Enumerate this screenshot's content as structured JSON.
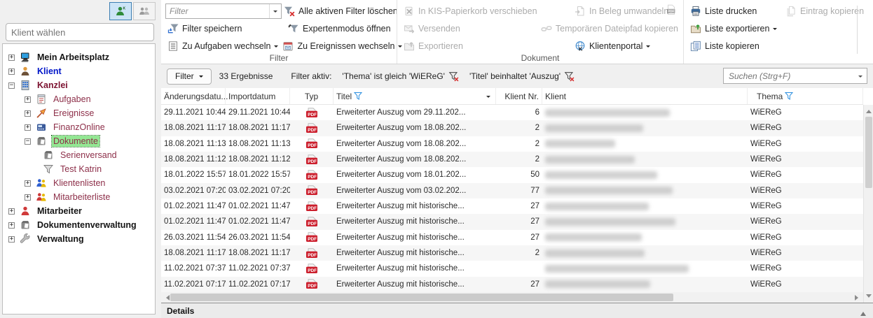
{
  "colors": {
    "selection_green": "#93e793",
    "pdf_red": "#cc1f2d",
    "filter_funnel_blue": "#2b8fe0",
    "remove_x_red": "#d62b2b",
    "selected_mode_blue": "#cce4f7"
  },
  "sidebar": {
    "client_select_placeholder": "Klient wählen",
    "mode_buttons": [
      {
        "name": "single-client",
        "icon": "person-single",
        "selected": true
      },
      {
        "name": "client-group",
        "icon": "person-group",
        "selected": false
      }
    ],
    "tree": [
      {
        "label": "Mein Arbeitsplatz",
        "level": 0,
        "expand": "plus",
        "icon": "workstation",
        "variant": "root"
      },
      {
        "label": "Klient",
        "level": 0,
        "expand": "plus",
        "icon": "person-client",
        "variant": "root-blue"
      },
      {
        "label": "Kanzlei",
        "level": 0,
        "expand": "minus",
        "icon": "office-building",
        "variant": "root-maroon"
      },
      {
        "label": "Aufgaben",
        "level": 1,
        "expand": "plus",
        "icon": "notepad",
        "variant": "child"
      },
      {
        "label": "Ereignisse",
        "level": 1,
        "expand": "plus",
        "icon": "event-arrow",
        "variant": "child"
      },
      {
        "label": "FinanzOnline",
        "level": 1,
        "expand": "plus",
        "icon": "finanz-terminal",
        "variant": "child"
      },
      {
        "label": "Dokumente",
        "level": 1,
        "expand": "minus",
        "icon": "document-box",
        "variant": "child",
        "selected": true
      },
      {
        "label": "Serienversand",
        "level": 2,
        "expand": "none",
        "icon": "document-box",
        "variant": "child"
      },
      {
        "label": "Test Katrin",
        "level": 2,
        "expand": "none",
        "icon": "funnel-gray",
        "variant": "child"
      },
      {
        "label": "Klientenlisten",
        "level": 1,
        "expand": "plus",
        "icon": "people-blue",
        "variant": "child"
      },
      {
        "label": "Mitarbeiterliste",
        "level": 1,
        "expand": "plus",
        "icon": "people-red",
        "variant": "child"
      },
      {
        "label": "Mitarbeiter",
        "level": 0,
        "expand": "plus",
        "icon": "person-red",
        "variant": "root"
      },
      {
        "label": "Dokumentenverwaltung",
        "level": 0,
        "expand": "plus",
        "icon": "document-box",
        "variant": "root"
      },
      {
        "label": "Verwaltung",
        "level": 0,
        "expand": "plus",
        "icon": "wrench",
        "variant": "root"
      }
    ]
  },
  "ribbon": {
    "filter_group": {
      "label": "Filter",
      "combo_placeholder": "Filter",
      "clear_all": "Alle aktiven Filter löschen",
      "save": "Filter speichern",
      "expert": "Expertenmodus öffnen",
      "to_tasks": "Zu Aufgaben wechseln",
      "to_events": "Zu Ereignissen wechseln"
    },
    "document_group": {
      "label": "Dokument",
      "kis_trash": "In KIS-Papierkorb verschieben",
      "convert": "In Beleg umwandeln",
      "send": "Versenden",
      "copy_path": "Temporären Dateipfad kopieren",
      "export": "Exportieren",
      "portal": "Klientenportal"
    },
    "list_group": {
      "print": "Liste drucken",
      "export": "Liste exportieren",
      "copy": "Liste kopieren",
      "copy_entry": "Eintrag kopieren"
    }
  },
  "filterbar": {
    "filter_button": "Filter",
    "results": "33 Ergebnisse",
    "active_label": "Filter aktiv:",
    "filters": [
      "'Thema' ist gleich 'WiEReG'",
      "'Titel' beinhaltet 'Auszug'"
    ],
    "search_placeholder": "Suchen (Strg+F)"
  },
  "table": {
    "columns": {
      "aenderungsdatum": "Änderungsdatu...",
      "importdatum": "Importdatum",
      "typ": "Typ",
      "titel": "Titel",
      "klient_nr": "Klient Nr.",
      "klient": "Klient",
      "thema": "Thema"
    },
    "rows": [
      {
        "aenderungsdatum": "29.11.2021 10:44",
        "importdatum": "29.11.2021 10:44",
        "typ": "PDF",
        "titel": "Erweiterter Auszug vom 29.11.202...",
        "klient_nr": "6",
        "klient_redacted_width": 178,
        "thema": "WiEReG"
      },
      {
        "aenderungsdatum": "18.08.2021 11:17",
        "importdatum": "18.08.2021 11:17",
        "typ": "PDF",
        "titel": "Erweiterter Auszug vom 18.08.202...",
        "klient_nr": "2",
        "klient_redacted_width": 140,
        "thema": "WiEReG"
      },
      {
        "aenderungsdatum": "18.08.2021 11:13",
        "importdatum": "18.08.2021 11:13",
        "typ": "PDF",
        "titel": "Erweiterter Auszug vom 18.08.202...",
        "klient_nr": "2",
        "klient_redacted_width": 100,
        "thema": "WiEReG"
      },
      {
        "aenderungsdatum": "18.08.2021 11:12",
        "importdatum": "18.08.2021 11:12",
        "typ": "PDF",
        "titel": "Erweiterter Auszug vom 18.08.202...",
        "klient_nr": "2",
        "klient_redacted_width": 128,
        "thema": "WiEReG"
      },
      {
        "aenderungsdatum": "18.01.2022 15:57",
        "importdatum": "18.01.2022 15:57",
        "typ": "PDF",
        "titel": "Erweiterter Auszug vom 18.01.202...",
        "klient_nr": "50",
        "klient_redacted_width": 160,
        "thema": "WiEReG"
      },
      {
        "aenderungsdatum": "03.02.2021 07:20",
        "importdatum": "03.02.2021 07:20",
        "typ": "PDF",
        "titel": "Erweiterter Auszug vom 03.02.202...",
        "klient_nr": "77",
        "klient_redacted_width": 182,
        "thema": "WiEReG"
      },
      {
        "aenderungsdatum": "01.02.2021 11:47",
        "importdatum": "01.02.2021 11:47",
        "typ": "PDF",
        "titel": "Erweiterter Auszug mit historische...",
        "klient_nr": "27",
        "klient_redacted_width": 148,
        "thema": "WiEReG"
      },
      {
        "aenderungsdatum": "01.02.2021 11:47",
        "importdatum": "01.02.2021 11:47",
        "typ": "PDF",
        "titel": "Erweiterter Auszug mit historische...",
        "klient_nr": "27",
        "klient_redacted_width": 186,
        "thema": "WiEReG"
      },
      {
        "aenderungsdatum": "26.03.2021 11:54",
        "importdatum": "26.03.2021 11:54",
        "typ": "PDF",
        "titel": "Erweiterter Auszug mit historische...",
        "klient_nr": "27",
        "klient_redacted_width": 138,
        "thema": "WiEReG"
      },
      {
        "aenderungsdatum": "18.08.2021 11:17",
        "importdatum": "18.08.2021 11:17",
        "typ": "PDF",
        "titel": "Erweiterter Auszug mit historische...",
        "klient_nr": "2",
        "klient_redacted_width": 142,
        "thema": "WiEReG"
      },
      {
        "aenderungsdatum": "11.02.2021 07:37",
        "importdatum": "11.02.2021 07:37",
        "typ": "PDF",
        "titel": "Erweiterter Auszug mit historische...",
        "klient_nr": "",
        "klient_redacted_width": 205,
        "thema": "WiEReG"
      },
      {
        "aenderungsdatum": "11.02.2021 07:17",
        "importdatum": "11.02.2021 07:17",
        "typ": "PDF",
        "titel": "Erweiterter Auszug mit historische...",
        "klient_nr": "27",
        "klient_redacted_width": 150,
        "thema": "WiEReG"
      }
    ]
  },
  "details": {
    "title": "Details"
  }
}
